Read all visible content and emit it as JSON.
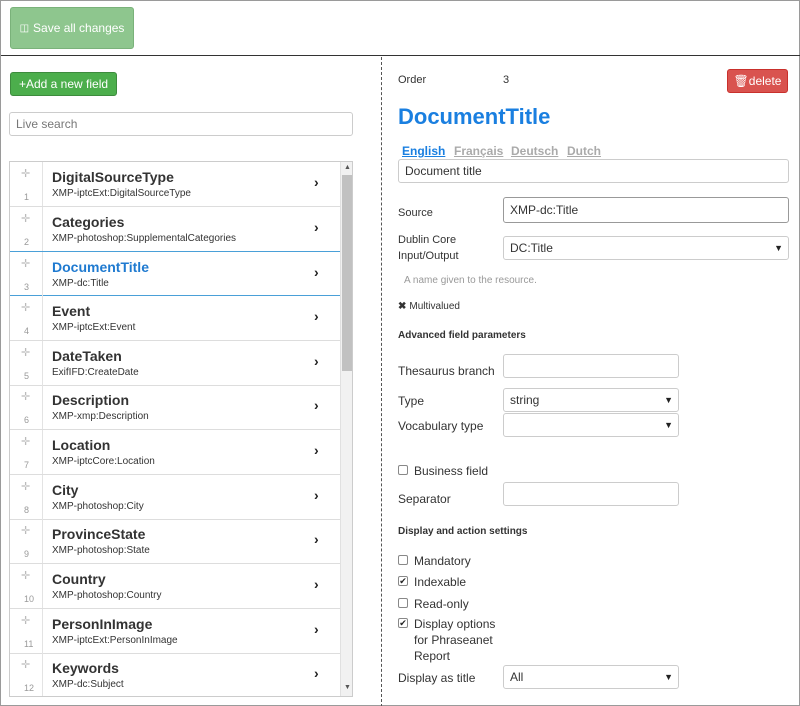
{
  "toolbar": {
    "save_label": "Save all changes"
  },
  "left": {
    "add_label": "+Add a new field",
    "search_placeholder": "Live search",
    "fields": [
      {
        "num": "1",
        "title": "DigitalSourceType",
        "sub": "XMP-iptcExt:DigitalSourceType"
      },
      {
        "num": "2",
        "title": "Categories",
        "sub": "XMP-photoshop:SupplementalCategories"
      },
      {
        "num": "3",
        "title": "DocumentTitle",
        "sub": "XMP-dc:Title"
      },
      {
        "num": "4",
        "title": "Event",
        "sub": "XMP-iptcExt:Event"
      },
      {
        "num": "5",
        "title": "DateTaken",
        "sub": "ExifIFD:CreateDate"
      },
      {
        "num": "6",
        "title": "Description",
        "sub": "XMP-xmp:Description"
      },
      {
        "num": "7",
        "title": "Location",
        "sub": "XMP-iptcCore:Location"
      },
      {
        "num": "8",
        "title": "City",
        "sub": "XMP-photoshop:City"
      },
      {
        "num": "9",
        "title": "ProvinceState",
        "sub": "XMP-photoshop:State"
      },
      {
        "num": "10",
        "title": "Country",
        "sub": "XMP-photoshop:Country"
      },
      {
        "num": "11",
        "title": "PersonInImage",
        "sub": "XMP-iptcExt:PersonInImage"
      },
      {
        "num": "12",
        "title": "Keywords",
        "sub": "XMP-dc:Subject"
      }
    ]
  },
  "detail": {
    "order_label": "Order",
    "order_value": "3",
    "delete_label": "delete",
    "title": "DocumentTitle",
    "languages": [
      "English",
      "Français",
      "Deutsch",
      "Dutch"
    ],
    "label_value": "Document title",
    "source_label": "Source",
    "source_value": "XMP-dc:Title",
    "dc_label_1": "Dublin Core",
    "dc_label_2": "Input/Output",
    "dc_value": "DC:Title",
    "dc_help": "A name given to the resource.",
    "multivalued": "Multivalued",
    "advanced_heading": "Advanced field parameters",
    "thesaurus_label": "Thesaurus branch",
    "type_label": "Type",
    "type_value": "string",
    "vocab_label": "Vocabulary type",
    "vocab_value": "",
    "business_label": "Business field",
    "separator_label": "Separator",
    "display_heading": "Display and action settings",
    "mandatory_label": "Mandatory",
    "indexable_label": "Indexable",
    "readonly_label": "Read-only",
    "report_label_1": "Display options",
    "report_label_2": "for Phraseanet",
    "report_label_3": "Report",
    "display_title_label": "Display as title",
    "display_title_value": "All",
    "checks": {
      "business": false,
      "mandatory": false,
      "indexable": true,
      "readonly": false,
      "report": true
    }
  }
}
